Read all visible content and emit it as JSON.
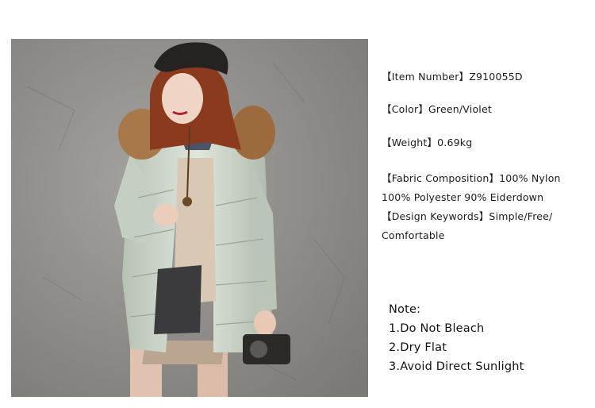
{
  "product_photo": {
    "alt": ""
  },
  "specs": {
    "item_number": "【Item Number】Z910055D",
    "color": "【Color】Green/Violet",
    "weight": "【Weight】0.69kg",
    "fabric_line1": "【Fabric Composition】100% Nylon",
    "fabric_line2": "100% Polyester  90% Eiderdown",
    "keywords_line1": "【Design Keywords】Simple/Free/",
    "keywords_line2": "Comfortable"
  },
  "notes": {
    "heading": "Note:",
    "items": [
      "1.Do Not Bleach",
      "2.Dry Flat",
      "3.Avoid Direct Sunlight"
    ]
  },
  "colors": {
    "wall": "#8e8c88",
    "coat": "#c9d3c6",
    "fur": "#a7784a",
    "hair": "#8a3b1d",
    "beret": "#262222"
  }
}
